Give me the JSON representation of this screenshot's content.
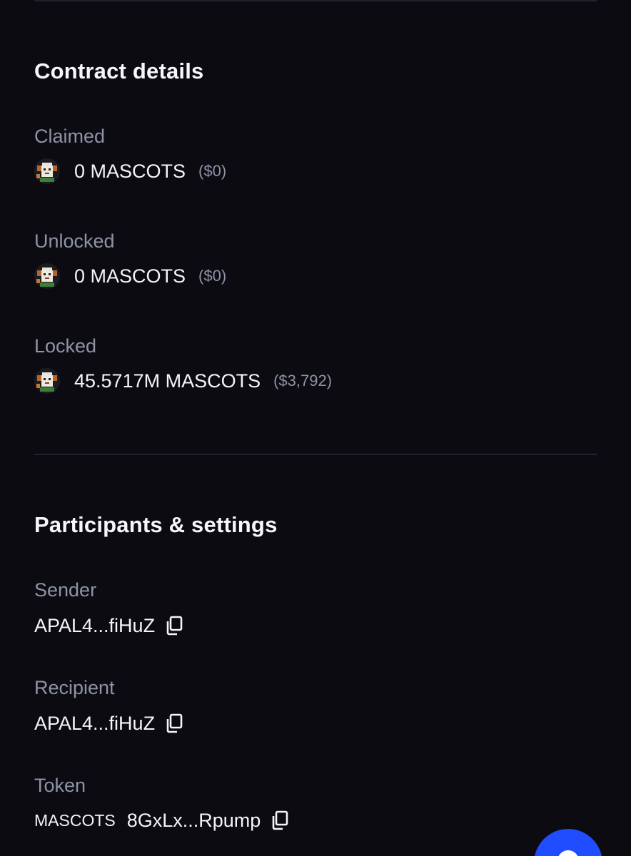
{
  "contract_details": {
    "title": "Contract details",
    "claimed": {
      "label": "Claimed",
      "amount": "0 MASCOTS",
      "usd": "($0)"
    },
    "unlocked": {
      "label": "Unlocked",
      "amount": "0 MASCOTS",
      "usd": "($0)"
    },
    "locked": {
      "label": "Locked",
      "amount": "45.5717M MASCOTS",
      "usd": "($3,792)"
    },
    "token_icon": "mascot-token-icon"
  },
  "participants": {
    "title": "Participants & settings",
    "sender": {
      "label": "Sender",
      "address": "APAL4...fiHuZ"
    },
    "recipient": {
      "label": "Recipient",
      "address": "APAL4...fiHuZ"
    },
    "token": {
      "label": "Token",
      "symbol": "MASCOTS",
      "address": "8GxLx...Rpump"
    },
    "copy_icon": "copy-icon"
  },
  "fab": {
    "icon": "chat-icon",
    "color": "#1f4dff"
  },
  "colors": {
    "background": "#0b0b11",
    "label": "#8e93a6",
    "text": "#f4f5f8",
    "divider": "#20222e"
  }
}
